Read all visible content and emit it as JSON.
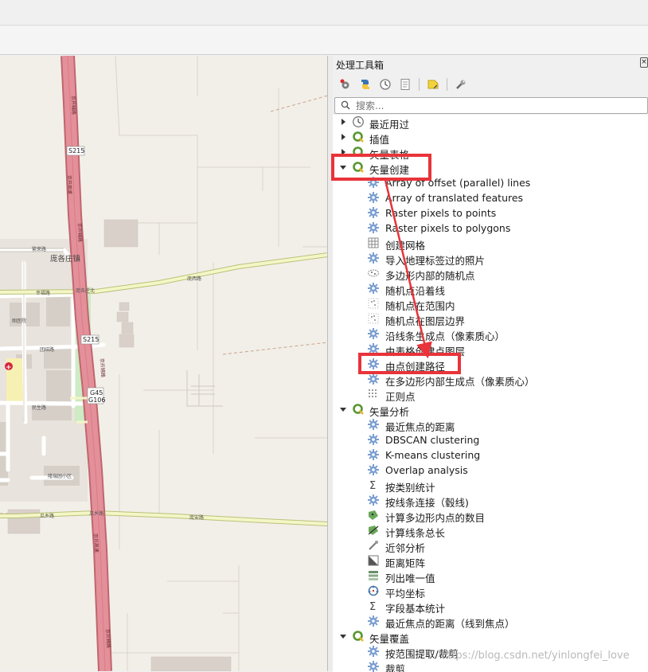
{
  "panel": {
    "title": "处理工具箱",
    "close_glyph": "×"
  },
  "toolbar_icons": [
    "gear-run-icon",
    "python-icon",
    "history-icon",
    "results-icon",
    "edit-tag-icon",
    "wrench-icon"
  ],
  "search": {
    "placeholder": "搜索..."
  },
  "tree": {
    "groups": [
      {
        "label": "最近用过",
        "icon": "clock-icon",
        "expanded": false
      },
      {
        "label": "插值",
        "icon": "qgis-icon",
        "expanded": false
      },
      {
        "label": "矢量表格",
        "icon": "qgis-icon",
        "expanded": false
      },
      {
        "label": "矢量创建",
        "icon": "qgis-icon",
        "expanded": true,
        "items": [
          "Array of offset (parallel) lines",
          "Array of translated features",
          "Raster pixels to points",
          "Raster pixels to polygons",
          "创建网格",
          "导入地理标签过的照片",
          "多边形内部的随机点",
          "随机点沿着线",
          "随机点在范围内",
          "随机点在图层边界",
          "沿线条生成点（像素质心）",
          "由表格创建点图层",
          "由点创建路径",
          "在多边形内部生成点（像素质心）",
          "正则点"
        ]
      },
      {
        "label": "矢量分析",
        "icon": "qgis-icon",
        "expanded": true,
        "items": [
          " 最近焦点的距离",
          "DBSCAN clustering",
          "K-means clustering",
          "Overlap analysis",
          "按类别统计",
          "按线条连接（毂线)",
          "计算多边形内点的数目",
          "计算线条总长",
          "近邻分析",
          "距离矩阵",
          "列出唯一值",
          "平均坐标",
          "字段基本统计",
          "最近焦点的距离（线到焦点）"
        ]
      },
      {
        "label": "矢量覆盖",
        "icon": "qgis-icon",
        "expanded": true,
        "items": [
          "按范围提取/裁剪",
          "裁剪"
        ]
      }
    ]
  },
  "map": {
    "labels": [
      "S215",
      "S215",
      "G45",
      "G106",
      "庞各庄镇",
      "庞各庄北",
      "庞西路",
      "幸福路",
      "团结路",
      "民生路",
      "瓜乡路",
      "瓜乡路",
      "庞安路",
      "京开辅路",
      "京开高速",
      "隆瑞园小区",
      "图医院",
      "繁荣路",
      "南中路",
      "育新大街"
    ]
  },
  "annotation": {
    "color": "#e8343a"
  },
  "watermark": "https://blog.csdn.net/yinlongfei_love"
}
